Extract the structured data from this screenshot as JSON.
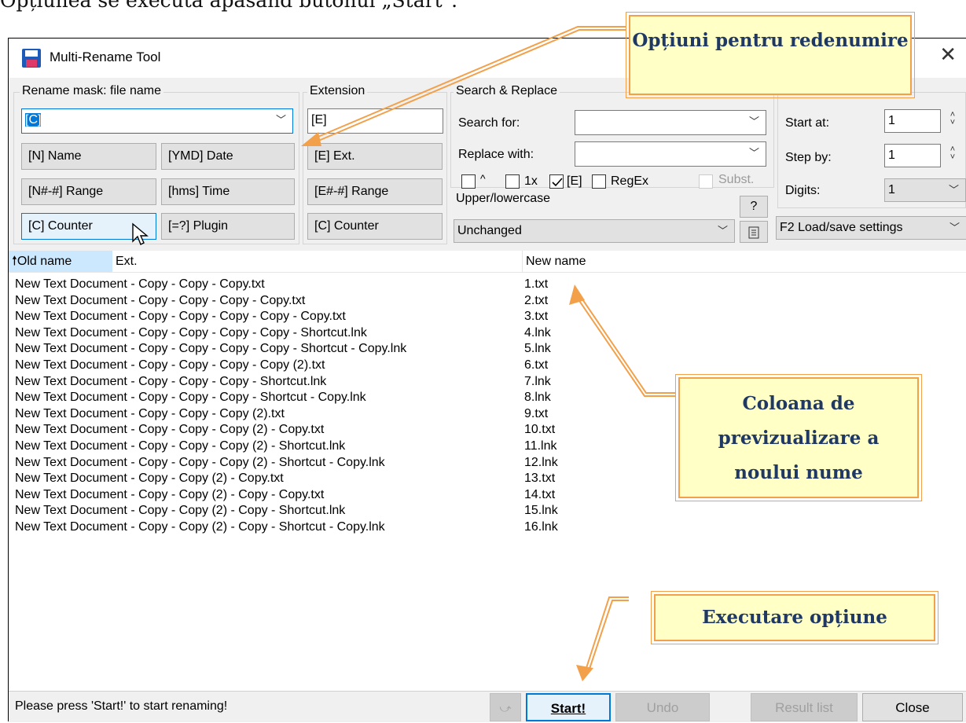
{
  "caption": "Opțiunea se execută apăsând butonul „Start\".",
  "window": {
    "title": "Multi-Rename Tool",
    "close": "✕"
  },
  "mask": {
    "label": "Rename mask: file name",
    "value": "[C]",
    "buttons": [
      "[N]  Name",
      "[YMD]  Date",
      "[N#-#] Range",
      "[hms]  Time",
      "[C]  Counter",
      "[=?]  Plugin"
    ]
  },
  "extension": {
    "label": "Extension",
    "value": "[E]",
    "buttons": [
      "[E]  Ext.",
      "[E#-#] Range",
      "[C]  Counter"
    ]
  },
  "search": {
    "label": "Search & Replace",
    "search_for": "Search for:",
    "replace_with": "Replace with:",
    "opt_caret": "^",
    "opt_1x": "1x",
    "opt_e": "[E]",
    "opt_regex": "RegEx",
    "opt_subst": "Subst."
  },
  "case": {
    "label": "Upper/lowercase",
    "value": "Unchanged",
    "help": "?"
  },
  "counter": {
    "start_label": "Start at:",
    "start_value": "1",
    "step_label": "Step by:",
    "step_value": "1",
    "digits_label": "Digits:",
    "digits_value": "1",
    "load_save": "F2 Load/save settings"
  },
  "columns": {
    "old": "Old name",
    "ext": "Ext.",
    "new": "New name"
  },
  "files": [
    {
      "old": "New Text Document - Copy - Copy - Copy.txt",
      "new": "1.txt"
    },
    {
      "old": "New Text Document - Copy - Copy - Copy - Copy.txt",
      "new": "2.txt"
    },
    {
      "old": "New Text Document - Copy - Copy - Copy - Copy - Copy.txt",
      "new": "3.txt"
    },
    {
      "old": "New Text Document - Copy - Copy - Copy - Copy - Shortcut.lnk",
      "new": "4.lnk"
    },
    {
      "old": "New Text Document - Copy - Copy - Copy - Copy - Shortcut - Copy.lnk",
      "new": "5.lnk"
    },
    {
      "old": "New Text Document - Copy - Copy - Copy - Copy (2).txt",
      "new": "6.txt"
    },
    {
      "old": "New Text Document - Copy - Copy - Copy - Shortcut.lnk",
      "new": "7.lnk"
    },
    {
      "old": "New Text Document - Copy - Copy - Copy - Shortcut - Copy.lnk",
      "new": "8.lnk"
    },
    {
      "old": "New Text Document - Copy - Copy - Copy (2).txt",
      "new": "9.txt"
    },
    {
      "old": "New Text Document - Copy - Copy - Copy (2) - Copy.txt",
      "new": "10.txt"
    },
    {
      "old": "New Text Document - Copy - Copy - Copy (2) - Shortcut.lnk",
      "new": "11.lnk"
    },
    {
      "old": "New Text Document - Copy - Copy - Copy (2) - Shortcut - Copy.lnk",
      "new": "12.lnk"
    },
    {
      "old": "New Text Document - Copy - Copy (2) - Copy.txt",
      "new": "13.txt"
    },
    {
      "old": "New Text Document - Copy - Copy (2) - Copy - Copy.txt",
      "new": "14.txt"
    },
    {
      "old": "New Text Document - Copy - Copy (2) - Copy - Shortcut.lnk",
      "new": "15.lnk"
    },
    {
      "old": "New Text Document - Copy - Copy (2) - Copy - Shortcut - Copy.lnk",
      "new": "16.lnk"
    }
  ],
  "status": {
    "message": "Please press 'Start!' to start renaming!",
    "start": "Start!",
    "undo": "Undo",
    "result_list": "Result list",
    "close": "Close"
  },
  "callouts": {
    "options": "Opțiuni pentru redenumire",
    "preview": "Coloana de previzualizare a noului nume",
    "execute": "Executare opțiune"
  },
  "colors": {
    "callout_fill": "#ffffc6",
    "callout_border": "#f3a04a",
    "callout_text": "#1f3864",
    "accent": "#0078d7"
  }
}
